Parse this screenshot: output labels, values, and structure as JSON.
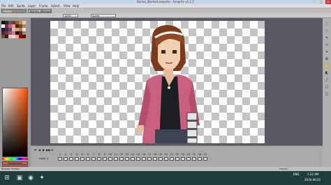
{
  "titlebar": {
    "title": "Karina_Worked.aseprite - Aseprite v1.1.7",
    "minimize": "–",
    "maximize": "□",
    "close": "×"
  },
  "menubar": {
    "items": [
      "File",
      "Edit",
      "Sprite",
      "Layer",
      "Frame",
      "Select",
      "View",
      "Help"
    ]
  },
  "tabs": [
    {
      "label": "Home"
    },
    {
      "label": "Karina_Worked"
    }
  ],
  "contextbar": {
    "zoom": "100%",
    "sprite": "Sprite"
  },
  "leftpanel": {
    "palette_colors": [
      "#000000",
      "#2b2b2b",
      "#5a5a5a",
      "#7a3b1c",
      "#a35629",
      "#c98a5a",
      "#e8c7a8",
      "#ffffff",
      "#8a2b46",
      "#c9607f",
      "#e394ad",
      "#3b2a1c",
      "#6b4a2b",
      "#b0856a",
      "#1f1f2f",
      "#333344",
      "#4e4e66",
      "#e8b99b",
      "#d99a7a",
      "#b67a5e",
      "#f2dccb",
      "#552233",
      "#7a3344",
      "#aa5566",
      "#cc7788",
      "#220011",
      "#443322",
      "#998877",
      "#665544",
      "#332211",
      "#ddccbb",
      "#eeddcc",
      "#ff9999",
      "#990000",
      "#660000"
    ],
    "fg_label": "Foreground",
    "bg_label": "Background",
    "fg_color": "#e05a44",
    "bg_color": "#c44b3a"
  },
  "timeline": {
    "layer_label": "Layer 1",
    "frame_numbers": [
      "1",
      "2",
      "3",
      "4",
      "5",
      "6",
      "7",
      "8",
      "9",
      "10",
      "11",
      "12",
      "13",
      "14",
      "15",
      "16",
      "17",
      "18",
      "19",
      "20",
      "21",
      "22",
      "23",
      "24",
      "25",
      "26",
      "27"
    ],
    "controls": [
      "⏮",
      "◀",
      "▶",
      "▶▶",
      "⏭"
    ]
  },
  "statusbar": {
    "left": "Bitmap Palette",
    "right": "Frame:"
  },
  "taskbar": {
    "time": "1:22 AM",
    "date": "2016-06-01",
    "lang": "ENG"
  },
  "canvas_bg": "#c4c4c4",
  "accent": "#4a6a8a"
}
